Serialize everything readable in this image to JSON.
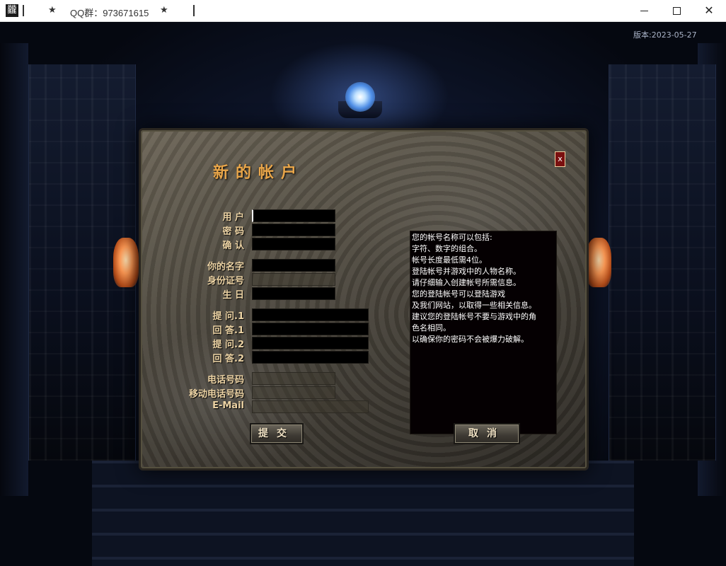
{
  "titlebar": {
    "app_icon_glyph": "龖",
    "star_left": "★",
    "title": "QQ群：973671615",
    "star_right": "★",
    "minimize_icon": "minimize-icon",
    "maximize_icon": "maximize-icon",
    "close_glyph": "✕"
  },
  "scene": {
    "version": "版本:2023-05-27"
  },
  "dialog": {
    "title": "新的帐户",
    "close_glyph": "x",
    "labels": {
      "username": "用 户",
      "password": "密 码",
      "confirm": "确 认",
      "your_name": "你的名字",
      "id_number": "身份证号",
      "birthday": "生 日",
      "question1": "提 问.1",
      "answer1": "回 答.1",
      "question2": "提 问.2",
      "answer2": "回 答.2",
      "phone": "电话号码",
      "mobile": "移动电话号码",
      "email": "E-Mail"
    },
    "values": {
      "username": "",
      "password": "",
      "confirm": "",
      "your_name": "",
      "id_number": "",
      "birthday": "",
      "question1": "",
      "answer1": "",
      "question2": "",
      "answer2": "",
      "phone": "",
      "mobile": "",
      "email": ""
    },
    "info_lines": [
      "您的帐号名称可以包括:",
      "字符、数字的组合。",
      "帐号长度最低需4位。",
      "登陆帐号并游戏中的人物名称。",
      "请仔细输入创建帐号所需信息。",
      "您的登陆帐号可以登陆游戏",
      "及我们网站，以取得一些相关信息。",
      "建议您的登陆帐号不要与游戏中的角",
      "色名相同。",
      "以确保你的密码不会被爆力破解。"
    ],
    "submit_label": "提交",
    "cancel_label": "取消"
  }
}
